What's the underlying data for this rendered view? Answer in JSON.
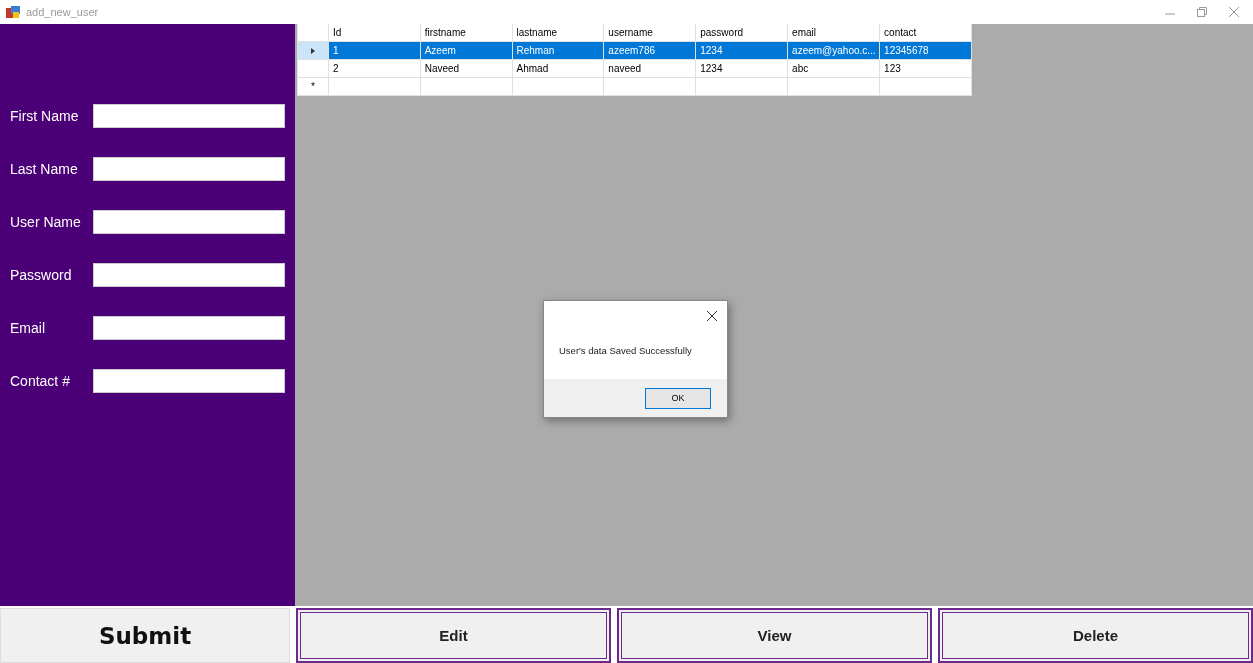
{
  "window": {
    "title": "add_new_user"
  },
  "form": {
    "fields": [
      {
        "label": "First Name"
      },
      {
        "label": "Last Name"
      },
      {
        "label": "User Name"
      },
      {
        "label": "Password"
      },
      {
        "label": "Email"
      },
      {
        "label": "Contact #"
      }
    ]
  },
  "grid": {
    "columns": [
      "Id",
      "firstname",
      "lastname",
      "username",
      "password",
      "email",
      "contact"
    ],
    "rows": [
      {
        "selected": true,
        "cells": [
          "1",
          "Azeem",
          "Rehman",
          "azeem786",
          "1234",
          "azeem@yahoo.c...",
          "12345678"
        ]
      },
      {
        "selected": false,
        "cells": [
          "2",
          "Naveed",
          "Ahmad",
          "naveed",
          "1234",
          "abc",
          "123"
        ]
      }
    ],
    "new_row_marker": "*"
  },
  "dialog": {
    "message": "User's data Saved Successfully",
    "button": "OK"
  },
  "buttons": [
    {
      "label": "Submit",
      "kind": "primary"
    },
    {
      "label": "Edit",
      "kind": "framed"
    },
    {
      "label": "View",
      "kind": "framed"
    },
    {
      "label": "Delete",
      "kind": "framed"
    }
  ]
}
